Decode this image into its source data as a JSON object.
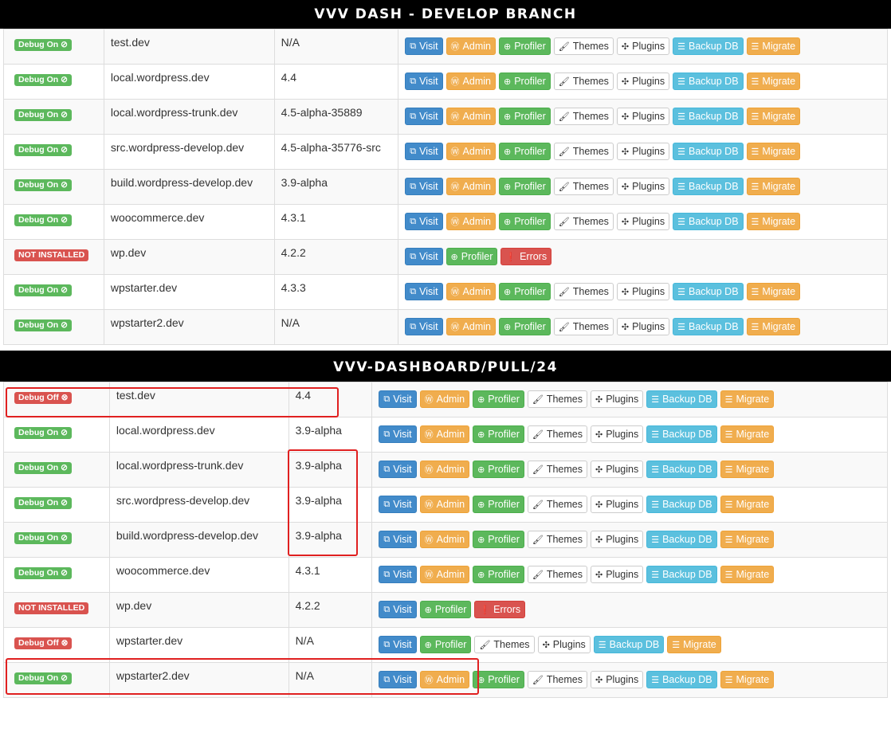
{
  "sections": [
    {
      "title": "VVV DASH  - DEVELOP BRANCH",
      "rows": [
        {
          "status": "Debug On ⊘",
          "status_type": "on",
          "site": "test.dev",
          "version": "N/A",
          "buttons": [
            "Visit",
            "Admin",
            "Profiler",
            "Themes",
            "Plugins",
            "Backup DB",
            "Migrate"
          ]
        },
        {
          "status": "Debug On ⊘",
          "status_type": "on",
          "site": "local.wordpress.dev",
          "version": "4.4",
          "buttons": [
            "Visit",
            "Admin",
            "Profiler",
            "Themes",
            "Plugins",
            "Backup DB",
            "Migrate"
          ]
        },
        {
          "status": "Debug On ⊘",
          "status_type": "on",
          "site": "local.wordpress-trunk.dev",
          "version": "4.5-alpha-35889",
          "buttons": [
            "Visit",
            "Admin",
            "Profiler",
            "Themes",
            "Plugins",
            "Backup DB",
            "Migrate"
          ]
        },
        {
          "status": "Debug On ⊘",
          "status_type": "on",
          "site": "src.wordpress-develop.dev",
          "version": "4.5-alpha-35776-src",
          "buttons": [
            "Visit",
            "Admin",
            "Profiler",
            "Themes",
            "Plugins",
            "Backup DB",
            "Migrate"
          ]
        },
        {
          "status": "Debug On ⊘",
          "status_type": "on",
          "site": "build.wordpress-develop.dev",
          "version": "3.9-alpha",
          "buttons": [
            "Visit",
            "Admin",
            "Profiler",
            "Themes",
            "Plugins",
            "Backup DB",
            "Migrate"
          ]
        },
        {
          "status": "Debug On ⊘",
          "status_type": "on",
          "site": "woocommerce.dev",
          "version": "4.3.1",
          "buttons": [
            "Visit",
            "Admin",
            "Profiler",
            "Themes",
            "Plugins",
            "Backup DB",
            "Migrate"
          ]
        },
        {
          "status": "NOT INSTALLED",
          "status_type": "ni",
          "site": "wp.dev",
          "version": "4.2.2",
          "buttons": [
            "Visit",
            "Profiler",
            "Errors"
          ]
        },
        {
          "status": "Debug On ⊘",
          "status_type": "on",
          "site": "wpstarter.dev",
          "version": "4.3.3",
          "buttons": [
            "Visit",
            "Admin",
            "Profiler",
            "Themes",
            "Plugins",
            "Backup DB",
            "Migrate"
          ]
        },
        {
          "status": "Debug On ⊘",
          "status_type": "on",
          "site": "wpstarter2.dev",
          "version": "N/A",
          "buttons": [
            "Visit",
            "Admin",
            "Profiler",
            "Themes",
            "Plugins",
            "Backup DB",
            "Migrate"
          ]
        }
      ]
    },
    {
      "title": "VVV-DASHBOARD/PULL/24",
      "rows": [
        {
          "status": "Debug Off ⊗",
          "status_type": "off",
          "site": "test.dev",
          "version": "4.4",
          "buttons": [
            "Visit",
            "Admin",
            "Profiler",
            "Themes",
            "Plugins",
            "Backup DB",
            "Migrate"
          ]
        },
        {
          "status": "Debug On ⊘",
          "status_type": "on",
          "site": "local.wordpress.dev",
          "version": "3.9-alpha",
          "buttons": [
            "Visit",
            "Admin",
            "Profiler",
            "Themes",
            "Plugins",
            "Backup DB",
            "Migrate"
          ]
        },
        {
          "status": "Debug On ⊘",
          "status_type": "on",
          "site": "local.wordpress-trunk.dev",
          "version": "3.9-alpha",
          "buttons": [
            "Visit",
            "Admin",
            "Profiler",
            "Themes",
            "Plugins",
            "Backup DB",
            "Migrate"
          ]
        },
        {
          "status": "Debug On ⊘",
          "status_type": "on",
          "site": "src.wordpress-develop.dev",
          "version": "3.9-alpha",
          "buttons": [
            "Visit",
            "Admin",
            "Profiler",
            "Themes",
            "Plugins",
            "Backup DB",
            "Migrate"
          ]
        },
        {
          "status": "Debug On ⊘",
          "status_type": "on",
          "site": "build.wordpress-develop.dev",
          "version": "3.9-alpha",
          "buttons": [
            "Visit",
            "Admin",
            "Profiler",
            "Themes",
            "Plugins",
            "Backup DB",
            "Migrate"
          ]
        },
        {
          "status": "Debug On ⊘",
          "status_type": "on",
          "site": "woocommerce.dev",
          "version": "4.3.1",
          "buttons": [
            "Visit",
            "Admin",
            "Profiler",
            "Themes",
            "Plugins",
            "Backup DB",
            "Migrate"
          ]
        },
        {
          "status": "NOT INSTALLED",
          "status_type": "ni",
          "site": "wp.dev",
          "version": "4.2.2",
          "buttons": [
            "Visit",
            "Profiler",
            "Errors"
          ]
        },
        {
          "status": "Debug Off ⊗",
          "status_type": "off",
          "site": "wpstarter.dev",
          "version": "N/A",
          "buttons": [
            "Visit",
            "Profiler",
            "Themes",
            "Plugins",
            "Backup DB",
            "Migrate"
          ]
        },
        {
          "status": "Debug On ⊘",
          "status_type": "on",
          "site": "wpstarter2.dev",
          "version": "N/A",
          "buttons": [
            "Visit",
            "Admin",
            "Profiler",
            "Themes",
            "Plugins",
            "Backup DB",
            "Migrate"
          ]
        }
      ]
    }
  ],
  "button_styles": {
    "Visit": {
      "style": "primary",
      "icon": "external-link-icon",
      "glyph": "⧉"
    },
    "Admin": {
      "style": "warning",
      "icon": "wordpress-icon",
      "glyph": "Ⓦ"
    },
    "Profiler": {
      "style": "success",
      "icon": "search-plus-icon",
      "glyph": "⊕"
    },
    "Themes": {
      "style": "default",
      "icon": "paintbrush-icon",
      "glyph": "🖌"
    },
    "Plugins": {
      "style": "default",
      "icon": "puzzle-icon",
      "glyph": "✣"
    },
    "Backup DB": {
      "style": "info",
      "icon": "database-icon",
      "glyph": "☰"
    },
    "Migrate": {
      "style": "warning",
      "icon": "database-icon",
      "glyph": "☰"
    },
    "Errors": {
      "style": "danger",
      "icon": "exclamation-circle-icon",
      "glyph": "❗"
    }
  },
  "colors": {
    "primary": "#428bca",
    "warning": "#f0ad4e",
    "success": "#5cb85c",
    "info": "#5bc0de",
    "danger": "#d9534f",
    "highlight": "#e02020"
  }
}
